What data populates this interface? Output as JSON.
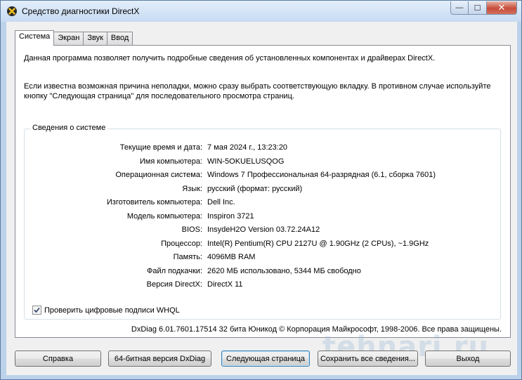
{
  "window": {
    "title": "Средство диагностики DirectX",
    "caption": {
      "minimize": "—",
      "maximize": "☐",
      "close": "✕"
    }
  },
  "tabs": [
    {
      "label": "Система",
      "active": true
    },
    {
      "label": "Экран",
      "active": false
    },
    {
      "label": "Звук",
      "active": false
    },
    {
      "label": "Ввод",
      "active": false
    }
  ],
  "system_tab": {
    "intro": "Данная программа позволяет получить подробные сведения об установленных компонентах и драйверах DirectX.",
    "hint": "Если известна возможная причина неполадки, можно сразу выбрать соответствующую вкладку. В противном случае используйте кнопку \"Следующая страница\" для последовательного просмотра страниц.",
    "group_title": "Сведения о системе",
    "info": [
      {
        "label": "Текущие время и дата:",
        "value": "7 мая 2024 г., 13:23:20"
      },
      {
        "label": "Имя компьютера:",
        "value": "WIN-5OKUELUSQOG"
      },
      {
        "label": "Операционная система:",
        "value": "Windows 7 Профессиональная 64-разрядная (6.1, сборка 7601)"
      },
      {
        "label": "Язык:",
        "value": "русский (формат: русский)"
      },
      {
        "label": "Изготовитель компьютера:",
        "value": "Dell Inc."
      },
      {
        "label": "Модель компьютера:",
        "value": "Inspiron 3721"
      },
      {
        "label": "BIOS:",
        "value": "InsydeH2O Version 03.72.24A12"
      },
      {
        "label": "Процессор:",
        "value": "Intel(R) Pentium(R) CPU 2127U @ 1.90GHz (2 CPUs), ~1.9GHz"
      },
      {
        "label": "Память:",
        "value": "4096MB RAM"
      },
      {
        "label": "Файл подкачки:",
        "value": "2620 МБ использовано, 5344 МБ свободно"
      },
      {
        "label": "Версия DirectX:",
        "value": "DirectX 11"
      }
    ],
    "whql_checkbox": {
      "label": "Проверить цифровые подписи WHQL",
      "checked": true
    },
    "footer": "DxDiag 6.01.7601.17514 32 бита Юникод  © Корпорация Майкрософт, 1998-2006.  Все права защищены."
  },
  "buttons": {
    "help": "Справка",
    "x64": "64-битная версия DxDiag",
    "next": "Следующая страница",
    "save": "Сохранить все сведения...",
    "exit": "Выход"
  },
  "watermark": "tehnari.ru",
  "icons": {
    "app": "directx-x-icon",
    "check": "checkmark-icon"
  }
}
